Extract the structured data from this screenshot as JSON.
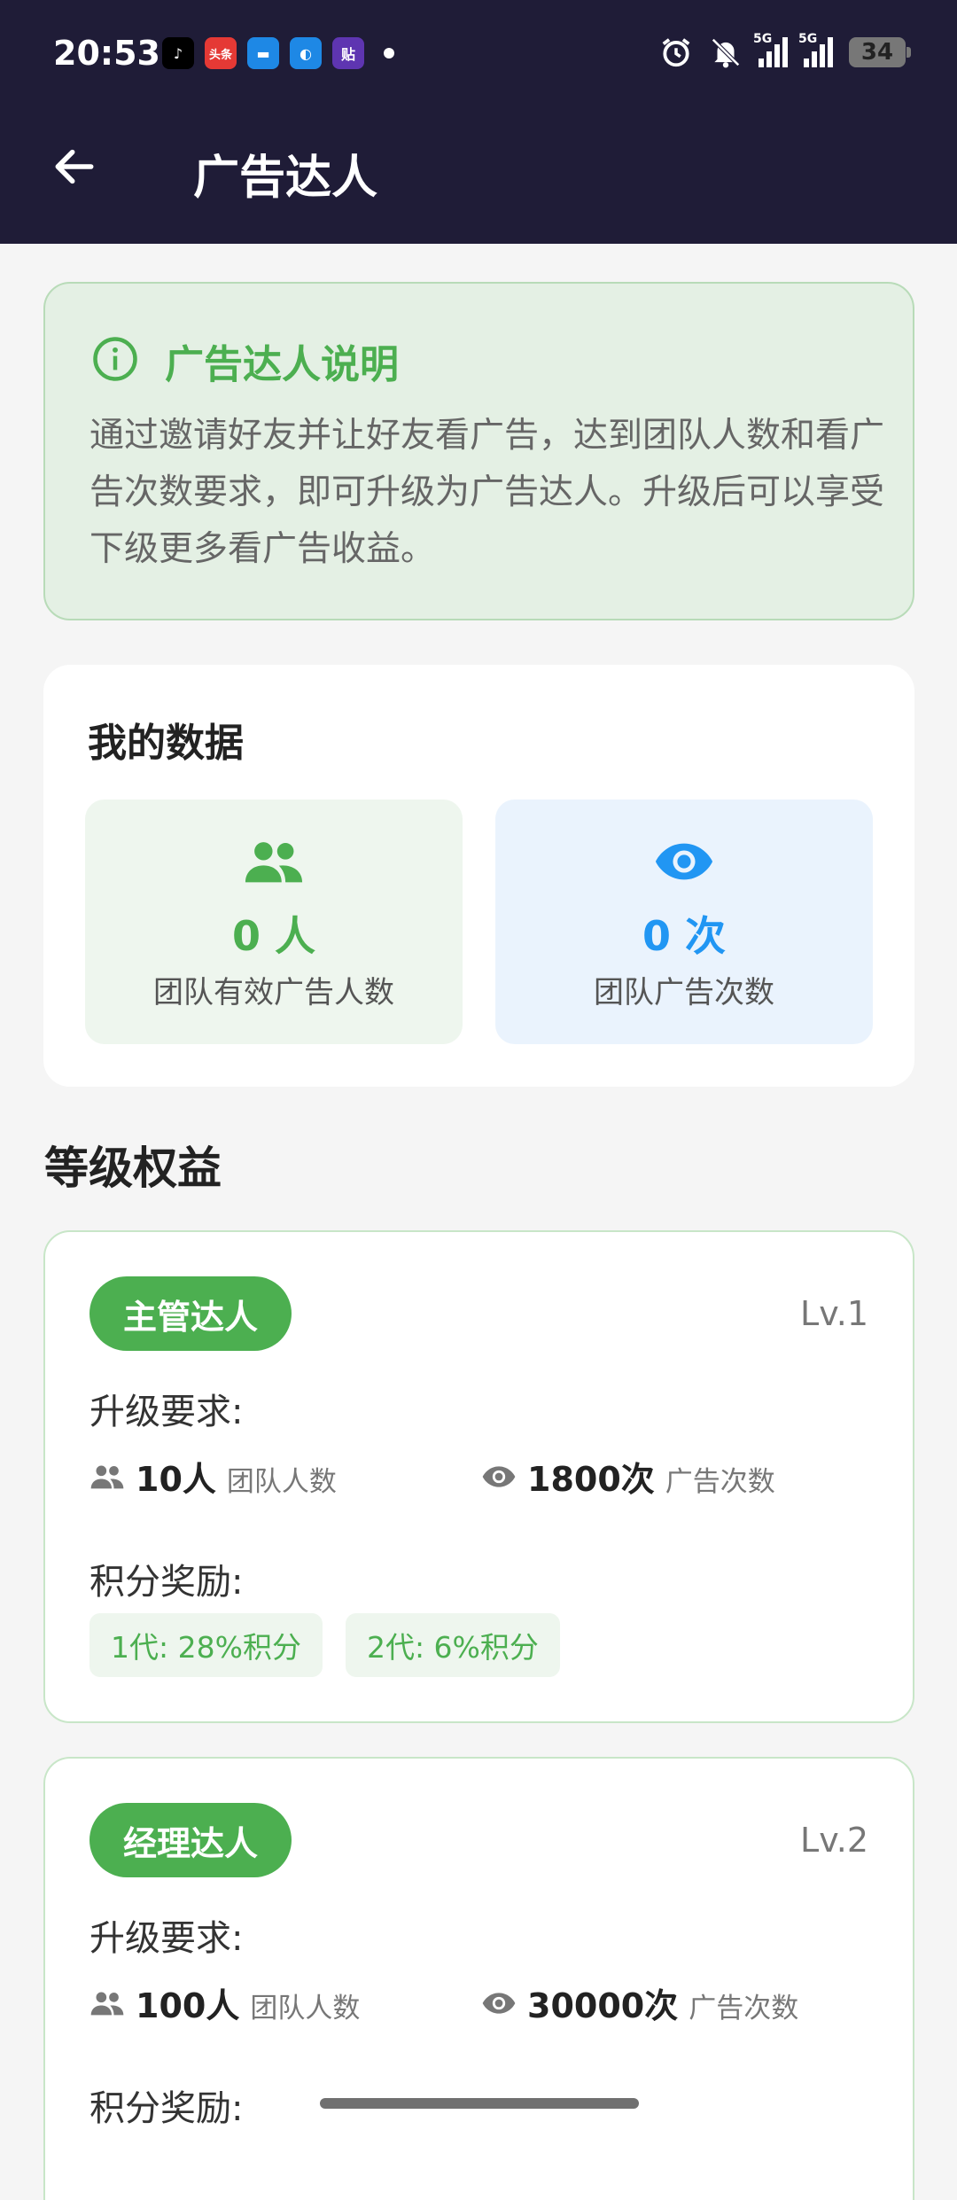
{
  "status_bar": {
    "time": "20:53",
    "apps": [
      {
        "icon": "tiktok-icon",
        "glyph": "♪",
        "color": "#000000"
      },
      {
        "icon": "toutiao-icon",
        "glyph": "头条",
        "color": "#e53935"
      },
      {
        "icon": "message-icon",
        "glyph": "▬",
        "color": "#1e88e5"
      },
      {
        "icon": "browser-icon",
        "glyph": "◐",
        "color": "#1e88e5"
      },
      {
        "icon": "tieba-icon",
        "glyph": "贴",
        "color": "#5e35b1"
      }
    ],
    "signal_5g_1": "5G",
    "signal_5g_2": "5G",
    "battery": "34"
  },
  "header": {
    "title": "广告达人"
  },
  "intro": {
    "title": "广告达人说明",
    "text": "通过邀请好友并让好友看广告，达到团队人数和看广告次数要求，即可升级为广告达人。升级后可以享受下级更多看广告收益。"
  },
  "my_data": {
    "title": "我的数据",
    "team": {
      "value": "0 人",
      "label": "团队有效广告人数"
    },
    "ads": {
      "value": "0 次",
      "label": "团队广告次数"
    }
  },
  "levels_section": {
    "title": "等级权益"
  },
  "levels": [
    {
      "name": "主管达人",
      "level": "Lv.1",
      "req_label": "升级要求:",
      "team_value": "10人",
      "team_caption": "团队人数",
      "ads_value": "1800次",
      "ads_caption": "广告次数",
      "reward_label": "积分奖励:",
      "rewards": [
        "1代: 28%积分",
        "2代: 6%积分"
      ]
    },
    {
      "name": "经理达人",
      "level": "Lv.2",
      "req_label": "升级要求:",
      "team_value": "100人",
      "team_caption": "团队人数",
      "ads_value": "30000次",
      "ads_caption": "广告次数",
      "reward_label": "积分奖励:"
    }
  ],
  "colors": {
    "header_bg": "#1f1c37",
    "accent_green": "#4caf50",
    "accent_blue": "#2196f3"
  }
}
